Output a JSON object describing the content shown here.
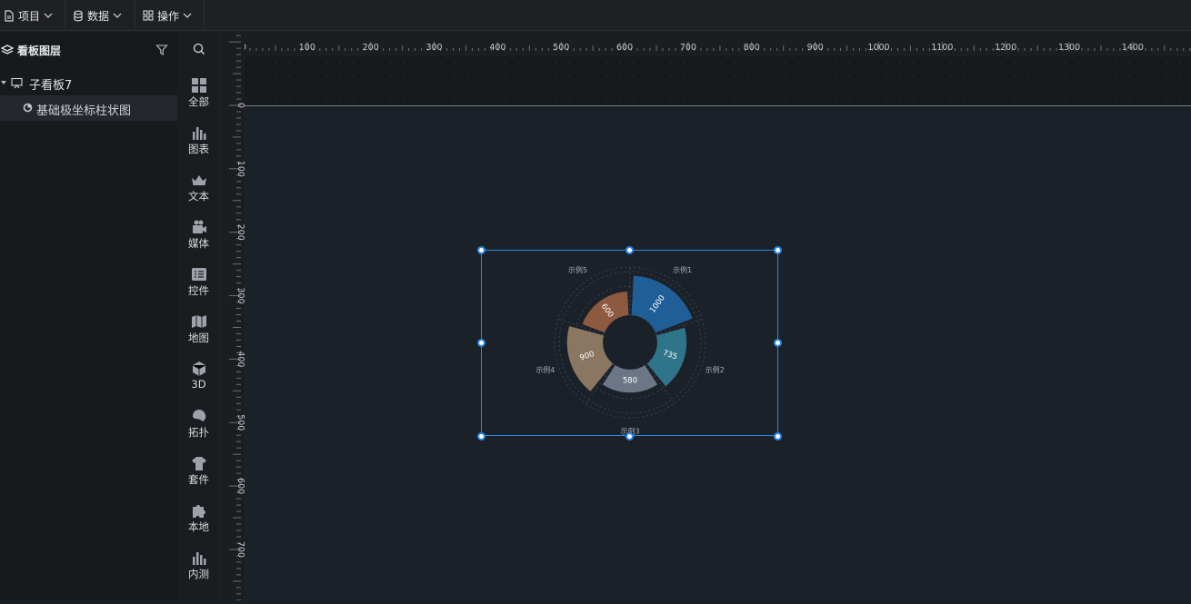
{
  "topbar": {
    "menus": [
      {
        "label": "项目",
        "icon": "file-icon"
      },
      {
        "label": "数据",
        "icon": "database-icon"
      },
      {
        "label": "操作",
        "icon": "grid-icon"
      }
    ]
  },
  "layers_panel": {
    "title": "看板图层",
    "tree": [
      {
        "label": "子看板7",
        "icon": "board-icon",
        "expanded": true
      },
      {
        "label": "基础极坐标柱状图",
        "icon": "chart-icon",
        "selected": true
      }
    ]
  },
  "components_panel": {
    "items": [
      {
        "label": "全部",
        "icon": "grid-icon"
      },
      {
        "label": "图表",
        "icon": "bar-chart-icon"
      },
      {
        "label": "文本",
        "icon": "text-icon"
      },
      {
        "label": "媒体",
        "icon": "media-icon"
      },
      {
        "label": "控件",
        "icon": "control-icon"
      },
      {
        "label": "地图",
        "icon": "map-icon"
      },
      {
        "label": "3D",
        "icon": "cube-icon"
      },
      {
        "label": "拓扑",
        "icon": "topology-icon"
      },
      {
        "label": "套件",
        "icon": "kit-icon"
      },
      {
        "label": "本地",
        "icon": "puzzle-icon"
      },
      {
        "label": "内测",
        "icon": "beta-chart-icon"
      }
    ]
  },
  "rulers": {
    "horizontal_labels": [
      "0",
      "100",
      "200",
      "300",
      "400",
      "500",
      "600",
      "700",
      "800",
      "900",
      "1000",
      "1100",
      "1200",
      "1300",
      "1400",
      "1"
    ],
    "vertical_labels": [
      "0",
      "100",
      "200",
      "300",
      "400",
      "500",
      "600",
      "700"
    ]
  },
  "colors": {
    "selection": "#2a88e6",
    "canvas": "#1b2129"
  },
  "chart_data": {
    "type": "bar",
    "coordinate_system": "polar",
    "categories": [
      "示例1",
      "示例2",
      "示例3",
      "示例4",
      "示例5"
    ],
    "values": [
      1000,
      735,
      580,
      900,
      600
    ],
    "colors": [
      "#1f5e96",
      "#2f7589",
      "#6c7687",
      "#8b7761",
      "#8d5a3f"
    ],
    "legend": "none",
    "grid": true
  }
}
